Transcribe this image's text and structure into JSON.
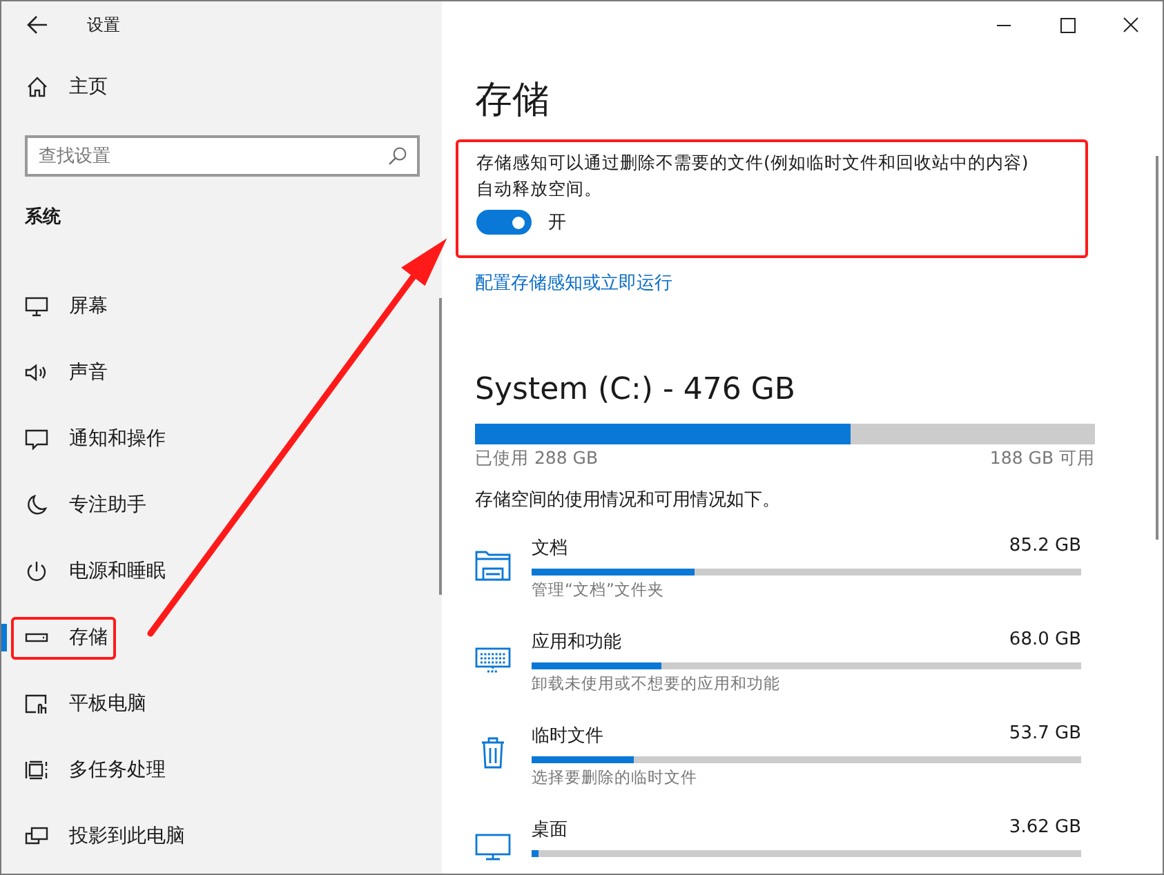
{
  "window": {
    "title": "设置"
  },
  "sidebar": {
    "home": "主页",
    "search": {
      "placeholder": "查找设置"
    },
    "section": "系统",
    "items": [
      {
        "kind": "display",
        "label": "屏幕",
        "selected": false
      },
      {
        "kind": "sound",
        "label": "声音",
        "selected": false
      },
      {
        "kind": "notifications",
        "label": "通知和操作",
        "selected": false
      },
      {
        "kind": "focus",
        "label": "专注助手",
        "selected": false
      },
      {
        "kind": "power",
        "label": "电源和睡眠",
        "selected": false
      },
      {
        "kind": "storage",
        "label": "存储",
        "selected": true
      },
      {
        "kind": "tablet",
        "label": "平板电脑",
        "selected": false
      },
      {
        "kind": "multitasking",
        "label": "多任务处理",
        "selected": false
      },
      {
        "kind": "projecting",
        "label": "投影到此电脑",
        "selected": false
      }
    ]
  },
  "page": {
    "title": "存储",
    "storage_sense": {
      "description": "存储感知可以通过删除不需要的文件(例如临时文件和回收站中的内容)自动释放空间。",
      "toggle": {
        "on": true,
        "label": "开"
      },
      "link": "配置存储感知或立即运行"
    },
    "drive": {
      "name": "System (C:) - 476 GB",
      "level": 0.605,
      "used": "已使用 288 GB",
      "free": "188 GB 可用"
    },
    "summary": "存储空间的使用情况和可用情况如下。",
    "categories": [
      {
        "kind": "documents",
        "name": "文档",
        "size": "85.2 GB",
        "level": 0.297,
        "description": "管理“文档”文件夹"
      },
      {
        "kind": "apps",
        "name": "应用和功能",
        "size": "68.0 GB",
        "level": 0.236,
        "description": "卸载未使用或不想要的应用和功能"
      },
      {
        "kind": "temp",
        "name": "临时文件",
        "size": "53.7 GB",
        "level": 0.186,
        "description": "选择要删除的临时文件"
      },
      {
        "kind": "desktop",
        "name": "桌面",
        "size": "3.62 GB",
        "level": 0.013
      }
    ]
  }
}
